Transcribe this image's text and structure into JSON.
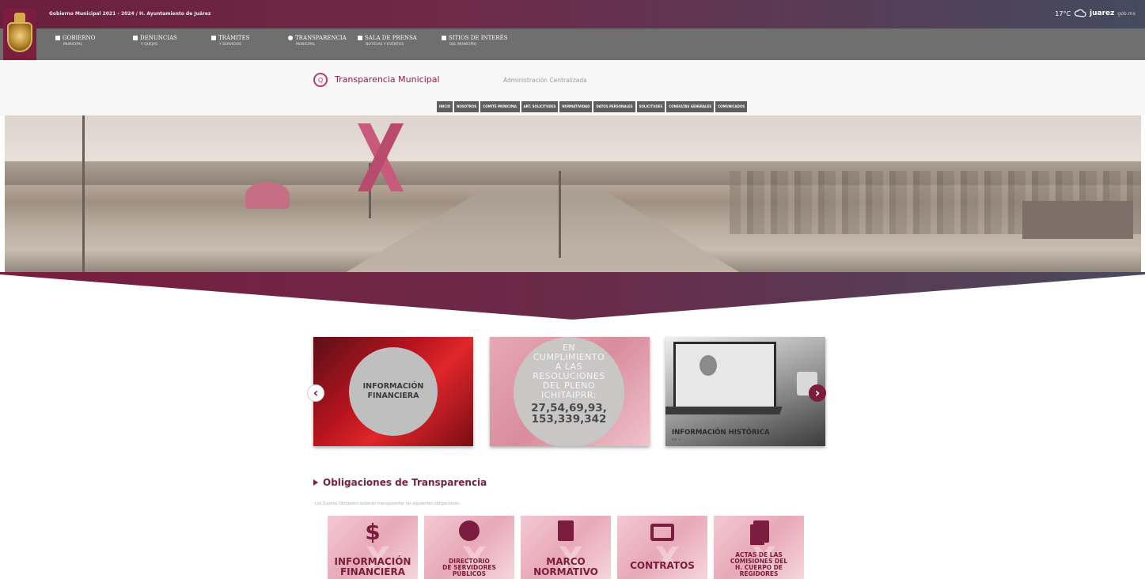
{
  "topbar": {
    "gov_text": "Gobierno Municipal 2021 - 2024 / H. Ayuntamiento de Juárez",
    "temperature": "17°C",
    "brand": "juarez",
    "brand_suffix": "gob.mx"
  },
  "mainnav": {
    "items": [
      {
        "label": "GOBIERNO",
        "sub": "MUNICIPAL"
      },
      {
        "label": "DENUNCIAS",
        "sub": "Y QUEJAS"
      },
      {
        "label": "TRÁMITES",
        "sub": "Y SERVICIOS"
      },
      {
        "label": "TRANSPARENCIA",
        "sub": "MUNICIPAL"
      },
      {
        "label": "SALA DE PRENSA",
        "sub": "NOTICIAS Y EVENTOS"
      },
      {
        "label": "SITIOS DE INTERÉS",
        "sub": "DEL MUNICIPIO"
      }
    ]
  },
  "section": {
    "title": "Transparencia Municipal",
    "subtitle": "Administración Centralizada",
    "subnav": [
      "INICIO",
      "NOSOTROS",
      "COMITÉ MUNICIPAL",
      "ART. SOLICITUDES",
      "NORMATIVIDAD",
      "DATOS PERSONALES",
      "SOLICITUDES",
      "CONSULTAS GENERALES",
      "COMUNICADOS"
    ]
  },
  "carousel": {
    "slide1": "INFORMACIÓN\nFINANCIERA",
    "slide2_text": "EN\nCUMPLIMIENTO\nA LAS\nRESOLUCIONES\nDEL PLENO\nICHITAIPRR:",
    "slide2_numbers": "27,54,69,93,\n153,339,342",
    "slide3_label": "INFORMACIÓN HISTÓRICA",
    "slide3_sub": "ver +"
  },
  "obligaciones": {
    "title": "Obligaciones de Transparencia",
    "subtitle": "Los Sujetos Obligados deberán transparentar las siguientes obligaciones:",
    "tiles": [
      {
        "label": "INFORMACIÓN\nFINANCIERA",
        "icon": "dollar-icon"
      },
      {
        "label": "DIRECTORIO\nDE SERVIDORES\nPÚBLICOS",
        "icon": "directory-icon"
      },
      {
        "label": "MARCO\nNORMATIVO",
        "icon": "document-icon"
      },
      {
        "label": "CONTRATOS",
        "icon": "briefcase-icon"
      },
      {
        "label": "ACTAS DE LAS\nCOMISIONES DEL\nH. CUERPO DE\nREGIDORES",
        "icon": "book-icon"
      }
    ]
  },
  "colors": {
    "brand": "#7a1d3f",
    "nav": "#6f6f6f",
    "tile": "#e8a8b8"
  }
}
